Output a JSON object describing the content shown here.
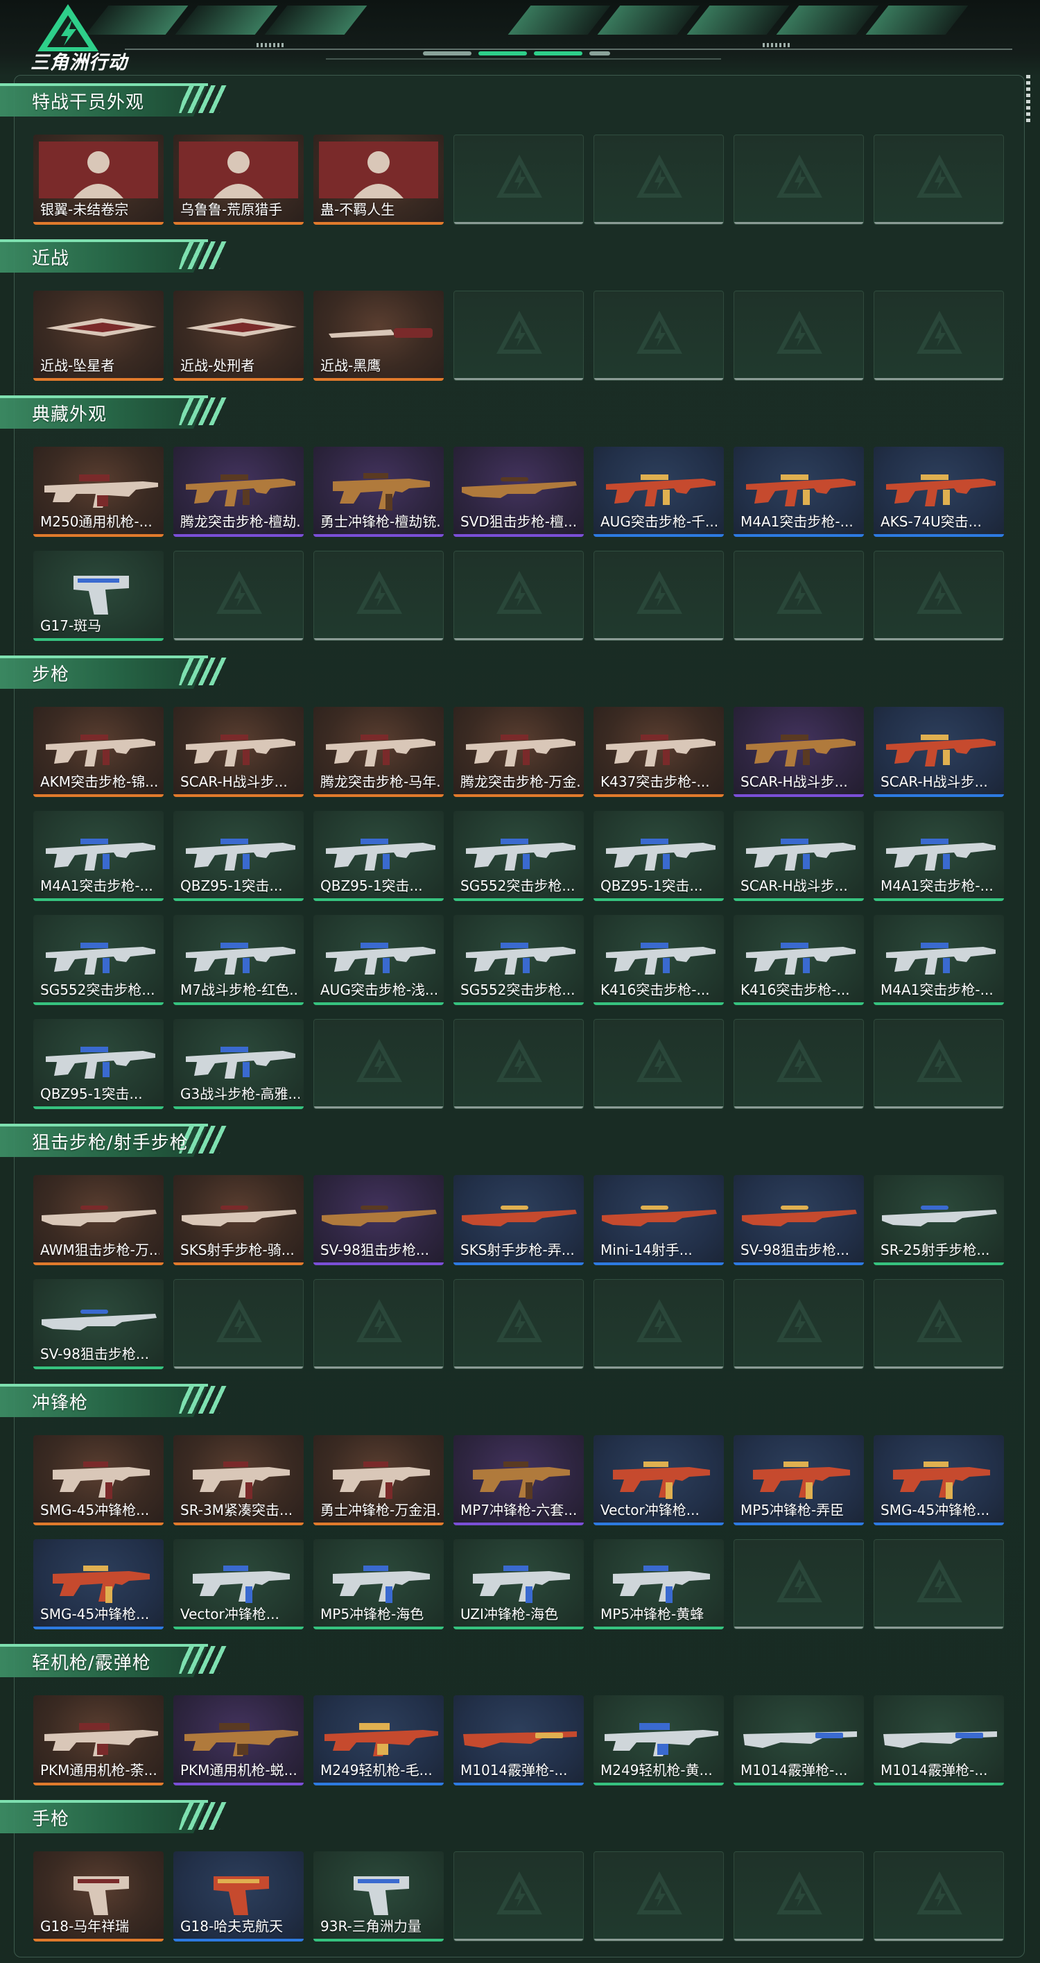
{
  "app": {
    "logo_text": "三角洲行动"
  },
  "colors": {
    "orange": "#e07a2c",
    "purple": "#7a4fd6",
    "blue": "#2d7ae0",
    "green": "#36c27f",
    "accent": "#7ee0b0",
    "background": "#182a22"
  },
  "sections": [
    {
      "title": "特战干员外观",
      "items": [
        {
          "label": "银翼-未结卷宗",
          "rarity": "orange",
          "icon": "operator-icon"
        },
        {
          "label": "乌鲁鲁-荒原猎手",
          "rarity": "orange",
          "icon": "operator-icon"
        },
        {
          "label": "蛊-不羁人生",
          "rarity": "orange",
          "icon": "operator-icon"
        }
      ]
    },
    {
      "title": "近战",
      "items": [
        {
          "label": "近战-坠星者",
          "rarity": "orange",
          "icon": "melee-icon"
        },
        {
          "label": "近战-处刑者",
          "rarity": "orange",
          "icon": "melee-icon"
        },
        {
          "label": "近战-黑鹰",
          "rarity": "orange",
          "icon": "knife-icon"
        }
      ]
    },
    {
      "title": "典藏外观",
      "items": [
        {
          "label": "M250通用机枪-...",
          "rarity": "orange",
          "icon": "machinegun-icon"
        },
        {
          "label": "腾龙突击步枪-檀劫...",
          "rarity": "purple",
          "icon": "rifle-icon"
        },
        {
          "label": "勇士冲锋枪-檀劫铳...",
          "rarity": "purple",
          "icon": "smg-icon"
        },
        {
          "label": "SVD狙击步枪-檀...",
          "rarity": "purple",
          "icon": "sniper-icon"
        },
        {
          "label": "AUG突击步枪-千...",
          "rarity": "blue",
          "icon": "rifle-icon"
        },
        {
          "label": "M4A1突击步枪-...",
          "rarity": "blue",
          "icon": "rifle-icon"
        },
        {
          "label": "AKS-74U突击...",
          "rarity": "blue",
          "icon": "rifle-icon"
        },
        {
          "label": "G17-斑马",
          "rarity": "green",
          "icon": "pistol-icon"
        }
      ]
    },
    {
      "title": "步枪",
      "items": [
        {
          "label": "AKM突击步枪-锦...",
          "rarity": "orange",
          "icon": "rifle-icon"
        },
        {
          "label": "SCAR-H战斗步...",
          "rarity": "orange",
          "icon": "rifle-icon"
        },
        {
          "label": "腾龙突击步枪-马年...",
          "rarity": "orange",
          "icon": "rifle-icon"
        },
        {
          "label": "腾龙突击步枪-万金...",
          "rarity": "orange",
          "icon": "rifle-icon"
        },
        {
          "label": "K437突击步枪-...",
          "rarity": "orange",
          "icon": "rifle-icon"
        },
        {
          "label": "SCAR-H战斗步...",
          "rarity": "purple",
          "icon": "rifle-icon"
        },
        {
          "label": "SCAR-H战斗步...",
          "rarity": "blue",
          "icon": "rifle-icon"
        },
        {
          "label": "M4A1突击步枪-...",
          "rarity": "green",
          "icon": "rifle-icon"
        },
        {
          "label": "QBZ95-1突击...",
          "rarity": "green",
          "icon": "rifle-icon"
        },
        {
          "label": "QBZ95-1突击...",
          "rarity": "green",
          "icon": "rifle-icon"
        },
        {
          "label": "SG552突击步枪...",
          "rarity": "green",
          "icon": "rifle-icon"
        },
        {
          "label": "QBZ95-1突击...",
          "rarity": "green",
          "icon": "rifle-icon"
        },
        {
          "label": "SCAR-H战斗步...",
          "rarity": "green",
          "icon": "rifle-icon"
        },
        {
          "label": "M4A1突击步枪-...",
          "rarity": "green",
          "icon": "rifle-icon"
        },
        {
          "label": "SG552突击步枪...",
          "rarity": "green",
          "icon": "rifle-icon"
        },
        {
          "label": "M7战斗步枪-红色...",
          "rarity": "green",
          "icon": "rifle-icon"
        },
        {
          "label": "AUG突击步枪-浅...",
          "rarity": "green",
          "icon": "rifle-icon"
        },
        {
          "label": "SG552突击步枪...",
          "rarity": "green",
          "icon": "rifle-icon"
        },
        {
          "label": "K416突击步枪-...",
          "rarity": "green",
          "icon": "rifle-icon"
        },
        {
          "label": "K416突击步枪-...",
          "rarity": "green",
          "icon": "rifle-icon"
        },
        {
          "label": "M4A1突击步枪-...",
          "rarity": "green",
          "icon": "rifle-icon"
        },
        {
          "label": "QBZ95-1突击...",
          "rarity": "green",
          "icon": "rifle-icon"
        },
        {
          "label": "G3战斗步枪-高雅...",
          "rarity": "green",
          "icon": "rifle-icon"
        }
      ]
    },
    {
      "title": "狙击步枪/射手步枪",
      "items": [
        {
          "label": "AWM狙击步枪-万...",
          "rarity": "orange",
          "icon": "sniper-icon"
        },
        {
          "label": "SKS射手步枪-骑...",
          "rarity": "orange",
          "icon": "sniper-icon"
        },
        {
          "label": "SV-98狙击步枪...",
          "rarity": "purple",
          "icon": "sniper-icon"
        },
        {
          "label": "SKS射手步枪-弄...",
          "rarity": "blue",
          "icon": "sniper-icon"
        },
        {
          "label": "Mini-14射手...",
          "rarity": "blue",
          "icon": "sniper-icon"
        },
        {
          "label": "SV-98狙击步枪...",
          "rarity": "blue",
          "icon": "sniper-icon"
        },
        {
          "label": "SR-25射手步枪...",
          "rarity": "green",
          "icon": "sniper-icon"
        },
        {
          "label": "SV-98狙击步枪...",
          "rarity": "green",
          "icon": "sniper-icon"
        }
      ]
    },
    {
      "title": "冲锋枪",
      "items": [
        {
          "label": "SMG-45冲锋枪...",
          "rarity": "orange",
          "icon": "smg-icon"
        },
        {
          "label": "SR-3M紧凑突击...",
          "rarity": "orange",
          "icon": "smg-icon"
        },
        {
          "label": "勇士冲锋枪-万金泪...",
          "rarity": "orange",
          "icon": "smg-icon"
        },
        {
          "label": "MP7冲锋枪-六套...",
          "rarity": "purple",
          "icon": "smg-icon"
        },
        {
          "label": "Vector冲锋枪...",
          "rarity": "blue",
          "icon": "smg-icon"
        },
        {
          "label": "MP5冲锋枪-弄臣",
          "rarity": "blue",
          "icon": "smg-icon"
        },
        {
          "label": "SMG-45冲锋枪...",
          "rarity": "blue",
          "icon": "smg-icon"
        },
        {
          "label": "SMG-45冲锋枪...",
          "rarity": "blue",
          "icon": "smg-icon"
        },
        {
          "label": "Vector冲锋枪...",
          "rarity": "green",
          "icon": "smg-icon"
        },
        {
          "label": "MP5冲锋枪-海色",
          "rarity": "green",
          "icon": "smg-icon"
        },
        {
          "label": "UZI冲锋枪-海色",
          "rarity": "green",
          "icon": "smg-icon"
        },
        {
          "label": "MP5冲锋枪-黄蜂",
          "rarity": "green",
          "icon": "smg-icon"
        }
      ]
    },
    {
      "title": "轻机枪/霰弹枪",
      "items": [
        {
          "label": "PKM通用机枪-荼...",
          "rarity": "orange",
          "icon": "machinegun-icon"
        },
        {
          "label": "PKM通用机枪-蜕...",
          "rarity": "purple",
          "icon": "machinegun-icon"
        },
        {
          "label": "M249轻机枪-毛...",
          "rarity": "blue",
          "icon": "machinegun-icon"
        },
        {
          "label": "M1014霰弹枪-...",
          "rarity": "blue",
          "icon": "shotgun-icon"
        },
        {
          "label": "M249轻机枪-黄...",
          "rarity": "green",
          "icon": "machinegun-icon"
        },
        {
          "label": "M1014霰弹枪-...",
          "rarity": "green",
          "icon": "shotgun-icon"
        },
        {
          "label": "M1014霰弹枪-...",
          "rarity": "green",
          "icon": "shotgun-icon"
        }
      ]
    },
    {
      "title": "手枪",
      "items": [
        {
          "label": "G18-马年祥瑞",
          "rarity": "orange",
          "icon": "pistol-icon"
        },
        {
          "label": "G18-哈夫克航天",
          "rarity": "blue",
          "icon": "pistol-icon"
        },
        {
          "label": "93R-三角洲力量",
          "rarity": "green",
          "icon": "pistol-icon"
        }
      ]
    }
  ]
}
